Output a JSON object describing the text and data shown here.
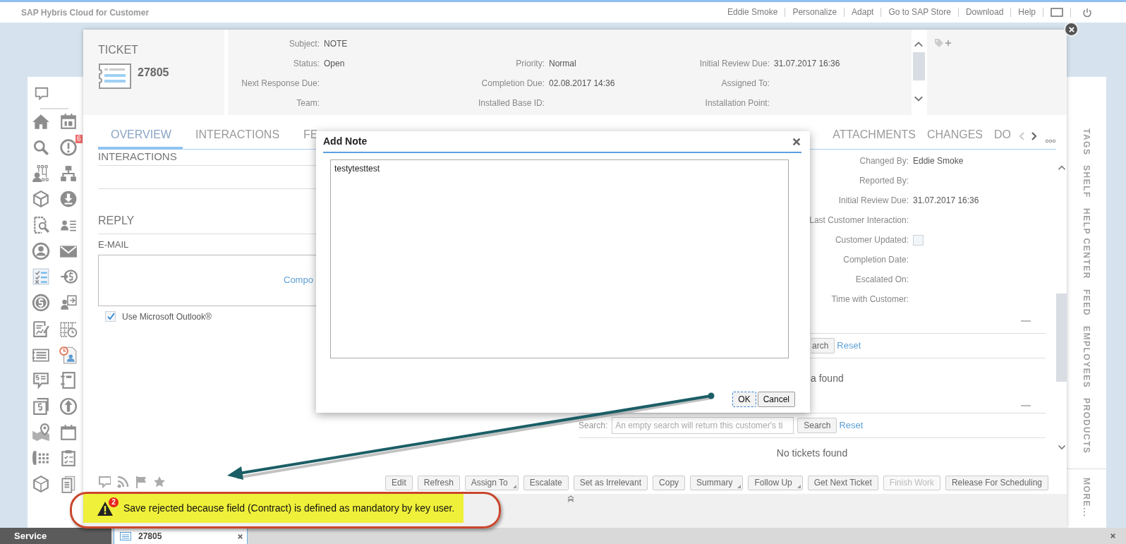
{
  "app": {
    "title": "SAP Hybris Cloud for Customer",
    "top_links": [
      "Eddie Smoke",
      "Personalize",
      "Adapt",
      "Go to SAP Store",
      "Download",
      "Help"
    ]
  },
  "sidebar": {
    "alert_count": "6"
  },
  "ticket": {
    "type_label": "TICKET",
    "number": "27805",
    "header_rows": [
      [
        {
          "label": "Subject:",
          "value": "NOTE"
        }
      ],
      [
        {
          "label": "Status:",
          "value": "Open"
        },
        {
          "label": "Priority:",
          "value": "Normal"
        },
        {
          "label": "Initial Review Due:",
          "value": "31.07.2017 16:36"
        }
      ],
      [
        {
          "label": "Next Response Due:"
        },
        {
          "label": "Completion Due:",
          "value": "02.08.2017 14:36"
        },
        {
          "label": "Assigned To:"
        }
      ],
      [
        {
          "label": "Team:"
        },
        {
          "label": "Installed Base ID:"
        },
        {
          "label": "Installation Point:"
        }
      ]
    ]
  },
  "tabs": [
    {
      "label": "OVERVIEW",
      "selected": true
    },
    {
      "label": "INTERACTIONS",
      "selected": false
    },
    {
      "label": "FE",
      "selected": false
    },
    {
      "label": "ATTACHMENTS",
      "selected": false
    },
    {
      "label": "CHANGES",
      "selected": false
    },
    {
      "label": "DO",
      "selected": false
    }
  ],
  "overview": {
    "interactions_heading": "INTERACTIONS",
    "reply_heading": "REPLY",
    "channel_label": "E-MAIL",
    "compose_link": "Compo",
    "outlook": {
      "label": "Use Microsoft Outlook®",
      "checked": true
    },
    "details": [
      {
        "label": "Changed By:",
        "value": "Eddie Smoke"
      },
      {
        "label": "Reported By:"
      },
      {
        "label": "Initial Review Due:",
        "value": "31.07.2017 16:36"
      },
      {
        "label": "Last Customer Interaction:"
      },
      {
        "label": "Customer Updated:",
        "kind": "checkbox",
        "checked": false
      },
      {
        "label": "Completion Date:"
      },
      {
        "label": "Escalated On:"
      },
      {
        "label": "Time with Customer:"
      }
    ],
    "documents": {
      "search_button": "arch",
      "reset_link": "Reset",
      "empty_text": "a found"
    },
    "tickets": {
      "search_label": "Search:",
      "search_placeholder": "An empty search will return this customer's ti",
      "search_button": "Search",
      "reset_link": "Reset",
      "empty_text": "No tickets found"
    }
  },
  "toolbar": [
    {
      "label": "Edit",
      "disabled": false,
      "menu": false
    },
    {
      "label": "Refresh",
      "disabled": false,
      "menu": false
    },
    {
      "label": "Assign To",
      "disabled": false,
      "menu": true
    },
    {
      "label": "Escalate",
      "disabled": false,
      "menu": false
    },
    {
      "label": "Set as Irrelevant",
      "disabled": false,
      "menu": false
    },
    {
      "label": "Copy",
      "disabled": false,
      "menu": false
    },
    {
      "label": "Summary",
      "disabled": false,
      "menu": true
    },
    {
      "label": "Follow Up",
      "disabled": false,
      "menu": true
    },
    {
      "label": "Get Next Ticket",
      "disabled": false,
      "menu": false
    },
    {
      "label": "Finish Work",
      "disabled": true,
      "menu": false
    },
    {
      "label": "Release For Scheduling",
      "disabled": false,
      "menu": false
    }
  ],
  "message": {
    "count": "2",
    "text": "Save rejected because field (Contract) is defined as mandatory by key user."
  },
  "side_tabs": [
    "TAGS",
    "SHELF",
    "HELP CENTER",
    "FEED",
    "EMPLOYEES",
    "PRODUCTS"
  ],
  "side_more": "MORE...",
  "dialog": {
    "title": "Add Note",
    "note": "testytesttest",
    "buttons": [
      {
        "label": "OK",
        "focused": true
      },
      {
        "label": "Cancel",
        "focused": false
      }
    ]
  },
  "taskbar": {
    "work_center": "Service",
    "tabs": [
      {
        "label": "27805",
        "selected": true
      }
    ]
  }
}
